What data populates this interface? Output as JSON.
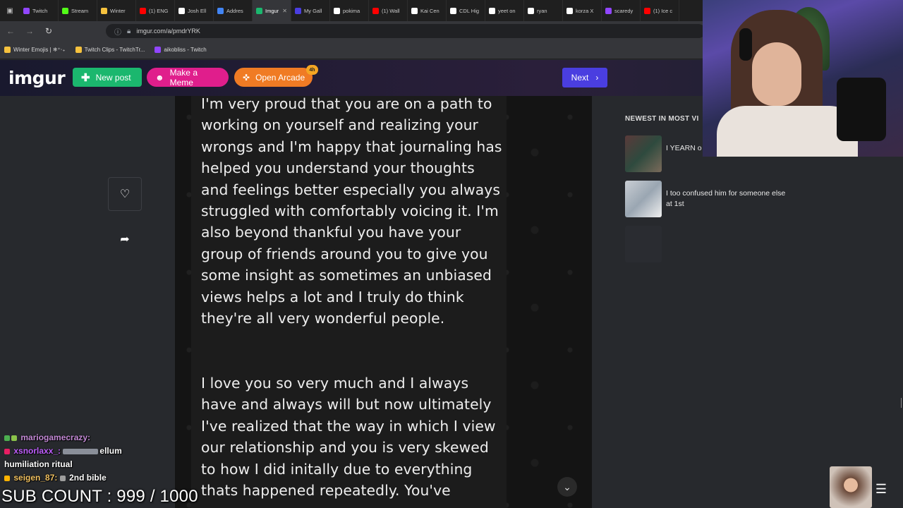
{
  "browser": {
    "tabs": [
      {
        "label": "Twitch",
        "color": "#9146ff"
      },
      {
        "label": "Stream",
        "color": "#53fc18"
      },
      {
        "label": "Winter",
        "color": "#f6c23e"
      },
      {
        "label": "(1) ENG",
        "color": "#ff0000"
      },
      {
        "label": "Josh Ell",
        "color": "#ffffff"
      },
      {
        "label": "Addres",
        "color": "#4285f4"
      },
      {
        "label": "Imgur",
        "color": "#1bb76e",
        "active": true
      },
      {
        "label": "My Gall",
        "color": "#4a3ee0"
      },
      {
        "label": "pokima",
        "color": "#ffffff"
      },
      {
        "label": "(1) Wall",
        "color": "#ff0000"
      },
      {
        "label": "Kai Cen",
        "color": "#ffffff"
      },
      {
        "label": "CDL Hig",
        "color": "#ffffff"
      },
      {
        "label": "yeet on",
        "color": "#ffffff"
      },
      {
        "label": "ryan",
        "color": "#ffffff"
      },
      {
        "label": "korza X",
        "color": "#ffffff"
      },
      {
        "label": "scaredy",
        "color": "#9146ff"
      },
      {
        "label": "(1) Ice c",
        "color": "#ff0000"
      }
    ],
    "url": "imgur.com/a/pmdrYRK",
    "bookmarks": [
      {
        "label": "Winter Emojis | ❄︎⁺‧₊",
        "color": "#f6c23e"
      },
      {
        "label": "Twitch Clips - TwitchTr...",
        "color": "#f6c23e"
      },
      {
        "label": "aikobliss - Twitch",
        "color": "#9146ff"
      }
    ]
  },
  "header": {
    "logo": "imgur",
    "new_post": "New post",
    "make_meme": "Make a Meme",
    "open_arcade": "Open Arcade",
    "arcade_badge": "4h",
    "next": "Next"
  },
  "post": {
    "paragraph1": "I'm very proud that you are on a path to working on yourself and realizing your wrongs and I'm happy that journaling has helped you understand your thoughts and feelings better especially you always struggled with comfortably voicing it. I'm also beyond thankful you have your group of friends around you to give you some insight as sometimes an unbiased views helps a lot and I truly do think they're all very wonderful people.",
    "paragraph2": "I love you so very much and I always have and always will but now ultimately I've realized that the way in which I view our relationship and you is very skewed to how I did initally due to everything thats happened repeatedly. You've"
  },
  "sidebar": {
    "title": "NEWEST IN MOST VI",
    "items": [
      {
        "label": "I YEARN o",
        "thumb_color": "#5a3a3a"
      },
      {
        "label": "I too confused him for someone else at 1st",
        "thumb_color": "#9aa6b2"
      },
      {
        "label": "",
        "thumb_color": "#2a2c31"
      }
    ]
  },
  "chat": [
    {
      "user": "mariogamecrazy:",
      "message": "",
      "user_color": "#c48ad6"
    },
    {
      "user": "xsnorlaxx_:",
      "message": "ellum",
      "user_color": "#c060ff"
    },
    {
      "user": "",
      "message": "humiliation ritual",
      "user_color": "#ffffff"
    },
    {
      "user": "seigen_87:",
      "message": "2nd bible",
      "user_color": "#f0c060"
    }
  ],
  "overlay": {
    "sub_count": "SUB COUNT : 999 / 1000"
  }
}
